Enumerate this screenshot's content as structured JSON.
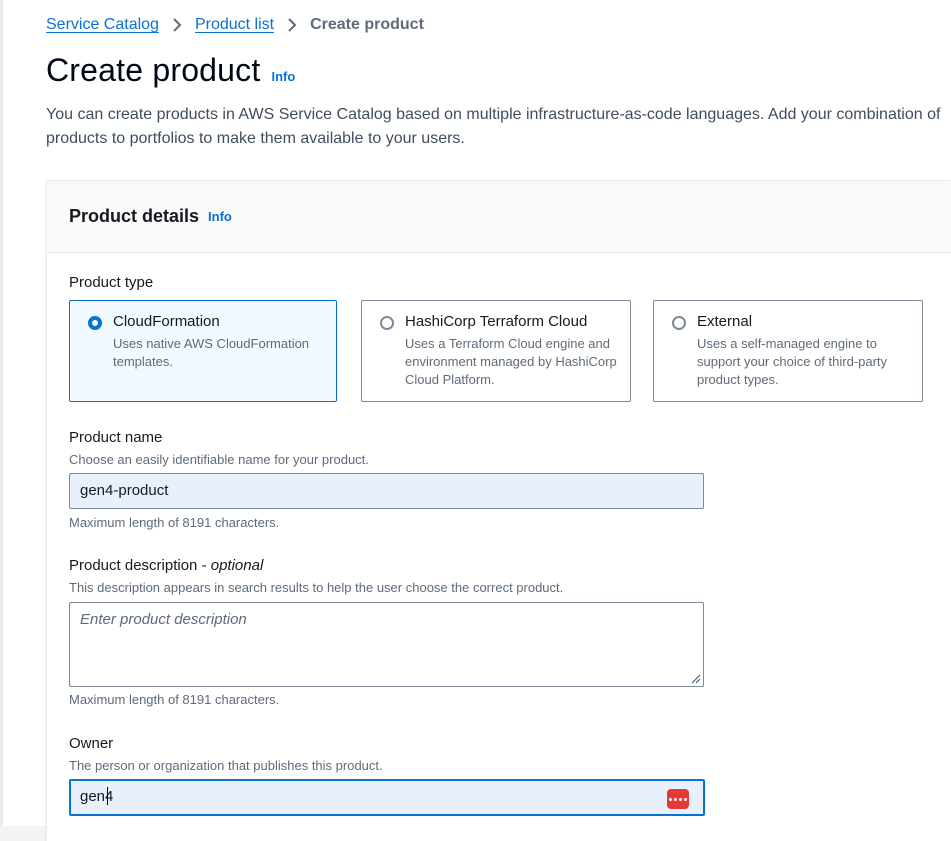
{
  "breadcrumb": {
    "items": [
      {
        "label": "Service Catalog"
      },
      {
        "label": "Product list"
      }
    ],
    "current": "Create product"
  },
  "page": {
    "title": "Create product",
    "info": "Info",
    "description": "You can create products in AWS Service Catalog based on multiple infrastructure-as-code languages. Add your combination of products to portfolios to make them available to your users.",
    "description_line1": "You can create products in AWS Service Catalog based on multiple infrastructure-as-code languages. Add your combination of",
    "description_line2": "products to portfolios to make them available to your users."
  },
  "panel": {
    "title": "Product details",
    "info": "Info"
  },
  "product_type": {
    "label": "Product type",
    "selected": "CloudFormation",
    "options": [
      {
        "title": "CloudFormation",
        "desc": "Uses native AWS CloudFormation templates."
      },
      {
        "title": "HashiCorp Terraform Cloud",
        "desc": "Uses a Terraform Cloud engine and environment managed by HashiCorp Cloud Platform."
      },
      {
        "title": "External",
        "desc": "Uses a self-managed engine to support your choice of third-party product types."
      }
    ]
  },
  "product_name": {
    "label": "Product name",
    "description": "Choose an easily identifiable name for your product.",
    "value": "gen4-product",
    "constraint": "Maximum length of 8191 characters."
  },
  "product_description": {
    "label": "Product description - ",
    "label_optional": "optional",
    "description": "This description appears in search results to help the user choose the correct product.",
    "placeholder": "Enter product description",
    "constraint": "Maximum length of 8191 characters."
  },
  "owner": {
    "label": "Owner",
    "description": "The person or organization that publishes this product.",
    "value": "gen4"
  },
  "colors": {
    "accent": "#0972d3",
    "selected_tile_bg": "#f1faff",
    "autofill_bg": "#e8f0fe",
    "password_manager_icon": "#e53935"
  }
}
